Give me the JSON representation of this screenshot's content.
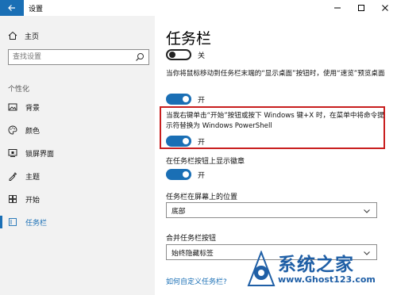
{
  "window": {
    "title": "设置",
    "controls": [
      "minimize",
      "maximize",
      "close"
    ]
  },
  "sidebar": {
    "home_label": "主页",
    "search": {
      "placeholder": "查找设置",
      "value": ""
    },
    "section_label": "个性化",
    "items": [
      {
        "label": "背景",
        "icon": "image-icon",
        "active": false
      },
      {
        "label": "颜色",
        "icon": "palette-icon",
        "active": false
      },
      {
        "label": "锁屏界面",
        "icon": "lock-screen-icon",
        "active": false
      },
      {
        "label": "主题",
        "icon": "theme-icon",
        "active": false
      },
      {
        "label": "开始",
        "icon": "start-icon",
        "active": false
      },
      {
        "label": "任务栏",
        "icon": "taskbar-icon",
        "active": true
      }
    ]
  },
  "main": {
    "title": "任务栏",
    "toggle_desktop_peek": {
      "state": "关",
      "on": false
    },
    "peek_description": "当你将鼠标移动到任务栏末端的“显示桌面”按钮时，使用“速览”预览桌面",
    "toggle_peek": {
      "state": "开",
      "on": true
    },
    "powershell_description": "当我右键单击“开始”按钮或按下 Windows 键+X 时，在菜单中将命令提示符替换为 Windows PowerShell",
    "toggle_powershell": {
      "state": "开",
      "on": true
    },
    "badges_label": "在任务栏按钮上显示徽章",
    "toggle_badges": {
      "state": "开",
      "on": true
    },
    "position_label": "任务栏在屏幕上的位置",
    "position_value": "底部",
    "combine_label": "合并任务栏按钮",
    "combine_value": "始终隐藏标签",
    "help_link": "如何自定义任务栏?"
  },
  "watermark": {
    "title": "系统之家",
    "url": "www.Ghost123.com"
  },
  "colors": {
    "accent": "#1a6fb5",
    "sidebar_bg": "#f2f2f2",
    "highlight_border": "#c81e1e",
    "watermark": "#1f5fa6"
  }
}
